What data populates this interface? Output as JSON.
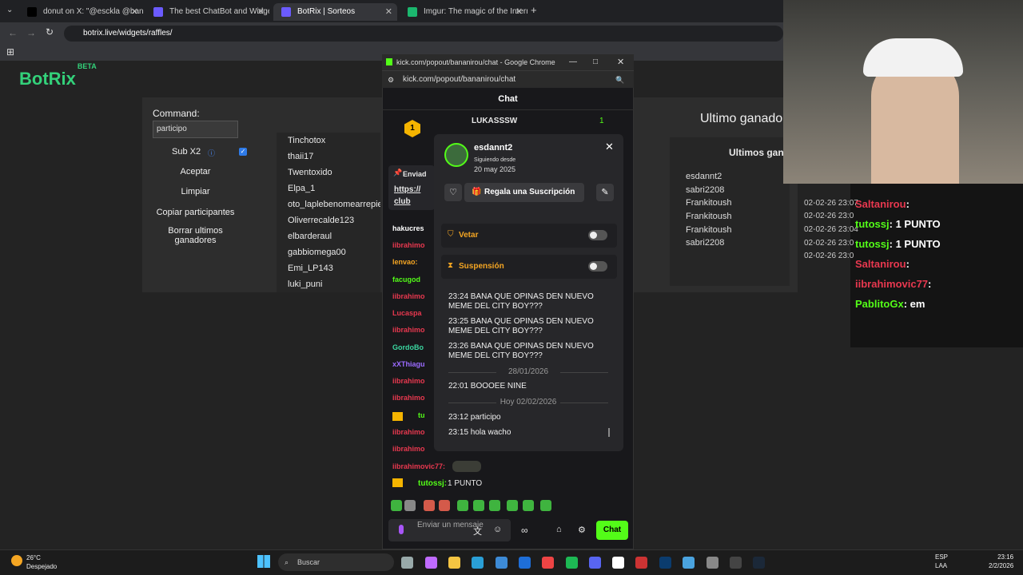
{
  "browser": {
    "tabs": [
      {
        "title": "donut on X: \"@esckla @banan",
        "color": "#000000"
      },
      {
        "title": "The best ChatBot and Widgets",
        "color": "#6b5bff"
      },
      {
        "title": "BotRix | Sorteos",
        "color": "#6b5bff"
      },
      {
        "title": "Imgur: The magic of the Interne",
        "color": "#1bb76e"
      }
    ],
    "url": "botrix.live/widgets/raffles/"
  },
  "botrix": {
    "logo": "BotRix",
    "beta": "BETA",
    "command_label": "Command:",
    "command_value": "participo",
    "sub_label": "Sub X2",
    "buttons": [
      "Aceptar",
      "Limpiar",
      "Copiar participantes",
      "Borrar ultimos ganadores"
    ],
    "participants": [
      "Tinchotox",
      "thaii17",
      "Twentoxido",
      "Elpa_1",
      "oto_laplebenomearrepiento",
      "Oliverrecalde123",
      "elbarderaul",
      "gabbiomega00",
      "Emi_LP143",
      "luki_puni"
    ],
    "last_winner_title": "Ultimo ganado",
    "winners_title": "Ultimos gan",
    "winners": [
      {
        "name": "esdannt2",
        "date": ""
      },
      {
        "name": "sabri2208",
        "date": "02-02-26 23:07"
      },
      {
        "name": "Frankitoush",
        "date": "02-02-26 23:0"
      },
      {
        "name": "Frankitoush",
        "date": "02-02-26 23:04"
      },
      {
        "name": "Frankitoush",
        "date": "02-02-26 23:0"
      },
      {
        "name": "sabri2208",
        "date": "02-02-26 23:0"
      }
    ]
  },
  "popup": {
    "window_title": "kick.com/popout/bananirou/chat - Google Chrome",
    "url": "kick.com/popout/bananirou/chat",
    "chat_header": "Chat",
    "top_user": "LUKASSSW",
    "top_count": "1",
    "pinned_label": "Enviad",
    "pinned_link": "https://",
    "pinned_link2": "club",
    "chat_names": [
      {
        "name": "hakucres",
        "color": "#ffffff"
      },
      {
        "name": "iibrahimo",
        "color": "#e8384f"
      },
      {
        "name": "lenvao:",
        "color": "#f5a623"
      },
      {
        "name": "facugod",
        "color": "#53fc18"
      },
      {
        "name": "iibrahimo",
        "color": "#e8384f"
      },
      {
        "name": "Lucaspa",
        "color": "#e8384f"
      },
      {
        "name": "iibrahimo",
        "color": "#e8384f"
      },
      {
        "name": "GordoBo",
        "color": "#3ad6a0"
      },
      {
        "name": "xXThiagu",
        "color": "#9b6bff"
      },
      {
        "name": "iibrahimo",
        "color": "#e8384f"
      },
      {
        "name": "iibrahimo",
        "color": "#e8384f"
      },
      {
        "name": "tu",
        "color": "#53fc18"
      },
      {
        "name": "iibrahimo",
        "color": "#e8384f"
      },
      {
        "name": "iibrahimo",
        "color": "#e8384f"
      }
    ],
    "bottom_msg1_user": "iibrahimovic77:",
    "bottom_msg2_user": "tutossj:",
    "bottom_msg2_text": "1 PUNTO",
    "input_placeholder": "Enviar un mensaje",
    "send_label": "Chat"
  },
  "card": {
    "username": "esdannt2",
    "following_since_label": "Siguiendo desde",
    "following_since_date": "20 may 2025",
    "gift_label": "Regala una Suscripción",
    "veto_label": "Vetar",
    "suspend_label": "Suspensión",
    "history": [
      {
        "type": "msg",
        "text": "23:24 BANA QUE OPINAS DEN NUEVO MEME DEL CITY BOY???"
      },
      {
        "type": "msg",
        "text": "23:25 BANA QUE OPINAS DEN NUEVO MEME DEL CITY BOY???"
      },
      {
        "type": "msg",
        "text": "23:26 BANA QUE OPINAS DEN NUEVO MEME DEL CITY BOY???"
      },
      {
        "type": "sep",
        "text": "28/01/2026"
      },
      {
        "type": "msg",
        "text": "22:01 BOOOEE NINE"
      },
      {
        "type": "sep",
        "text": "Hoy 02/02/2026"
      },
      {
        "type": "msg",
        "text": "23:12 participo"
      },
      {
        "type": "msg",
        "text": "23:15 hola wacho"
      }
    ]
  },
  "stream_overlay": [
    {
      "user": "Saltanirou",
      "text": ":",
      "color": "#e8384f"
    },
    {
      "user": "tutossj",
      "text": ": 1 PUNTO",
      "color": "#53fc18"
    },
    {
      "user": "tutossj",
      "text": ": 1 PUNTO",
      "color": "#53fc18"
    },
    {
      "user": "Saltanirou",
      "text": ":",
      "color": "#e8384f"
    },
    {
      "user": "iibrahimovic77",
      "text": ":",
      "color": "#e8384f"
    },
    {
      "user": "PablitoGx",
      "text": ": em",
      "color": "#53fc18"
    }
  ],
  "taskbar": {
    "temp": "26°C",
    "weather": "Despejado",
    "search": "Buscar",
    "lang1": "ESP",
    "lang2": "LAA",
    "time": "23:16",
    "date": "2/2/2026"
  }
}
